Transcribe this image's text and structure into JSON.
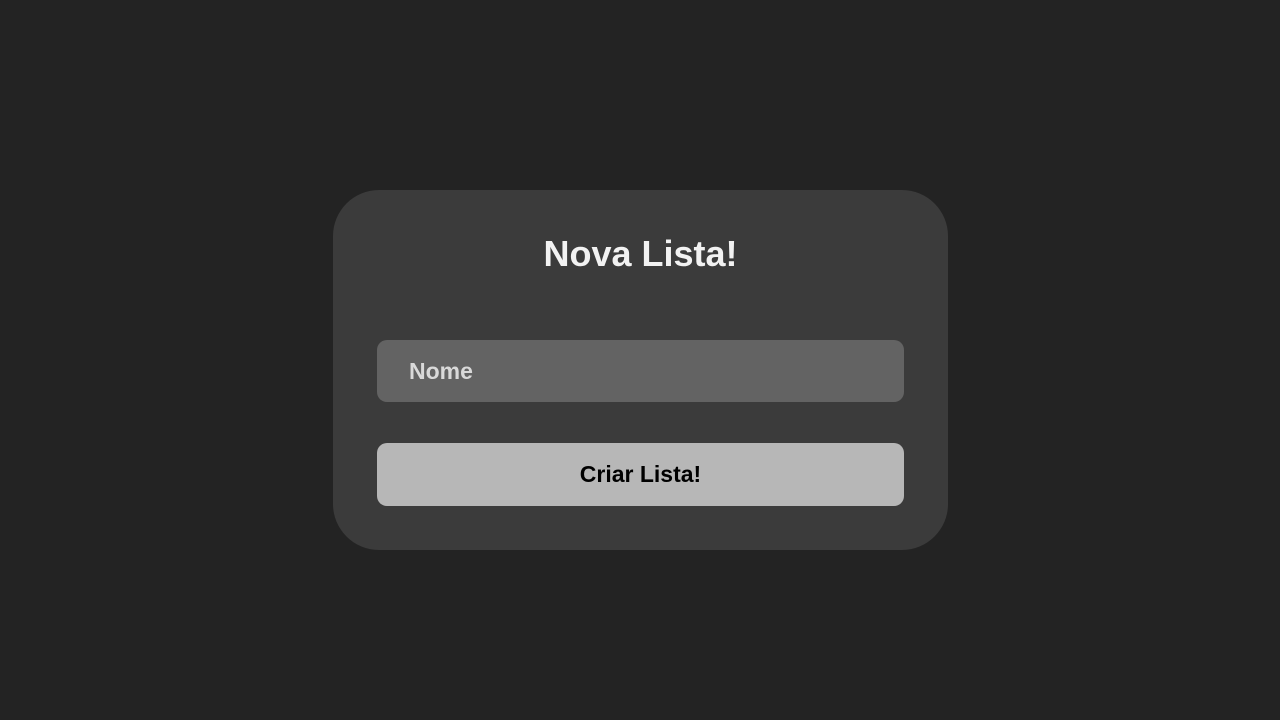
{
  "form": {
    "title": "Nova Lista!",
    "name_field": {
      "placeholder": "Nome",
      "value": ""
    },
    "submit_label": "Criar Lista!"
  },
  "colors": {
    "background": "#232323",
    "card": "#3b3b3b",
    "input": "#636363",
    "button": "#b7b7b7",
    "title_text": "#f2f2f2"
  }
}
